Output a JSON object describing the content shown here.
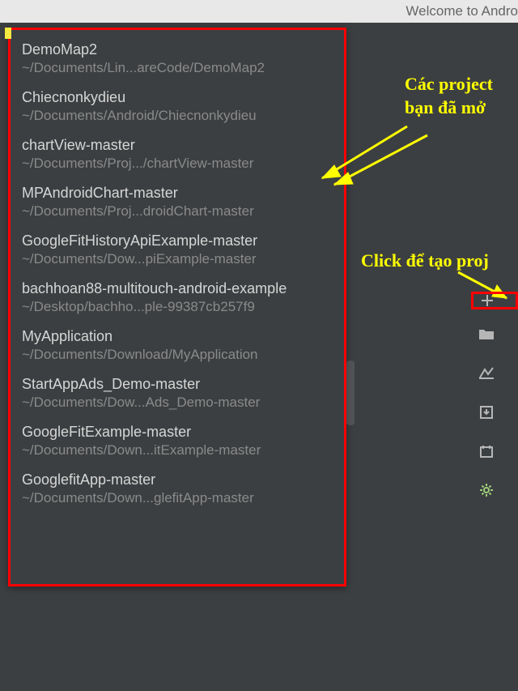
{
  "titlebar": {
    "text": "Welcome to Andro"
  },
  "recent_projects": [
    {
      "name": "DemoMap2",
      "path": "~/Documents/Lin...areCode/DemoMap2"
    },
    {
      "name": "Chiecnonkydieu",
      "path": "~/Documents/Android/Chiecnonkydieu"
    },
    {
      "name": "chartView-master",
      "path": "~/Documents/Proj.../chartView-master"
    },
    {
      "name": "MPAndroidChart-master",
      "path": "~/Documents/Proj...droidChart-master"
    },
    {
      "name": "GoogleFitHistoryApiExample-master",
      "path": "~/Documents/Dow...piExample-master"
    },
    {
      "name": "bachhoan88-multitouch-android-example",
      "path": "~/Desktop/bachho...ple-99387cb257f9"
    },
    {
      "name": "MyApplication",
      "path": "~/Documents/Download/MyApplication"
    },
    {
      "name": "StartAppAds_Demo-master",
      "path": "~/Documents/Dow...Ads_Demo-master"
    },
    {
      "name": "GoogleFitExample-master",
      "path": "~/Documents/Down...itExample-master"
    },
    {
      "name": "GooglefitApp-master",
      "path": "~/Documents/Down...glefitApp-master"
    }
  ],
  "annotations": {
    "opened_projects": "Các project\nbạn đã mở",
    "click_create": "Click để tạo proj"
  },
  "actions": {
    "new_project": "+",
    "open": "open",
    "vcs": "vcs",
    "import": "import",
    "sample": "sample",
    "config": "config"
  }
}
